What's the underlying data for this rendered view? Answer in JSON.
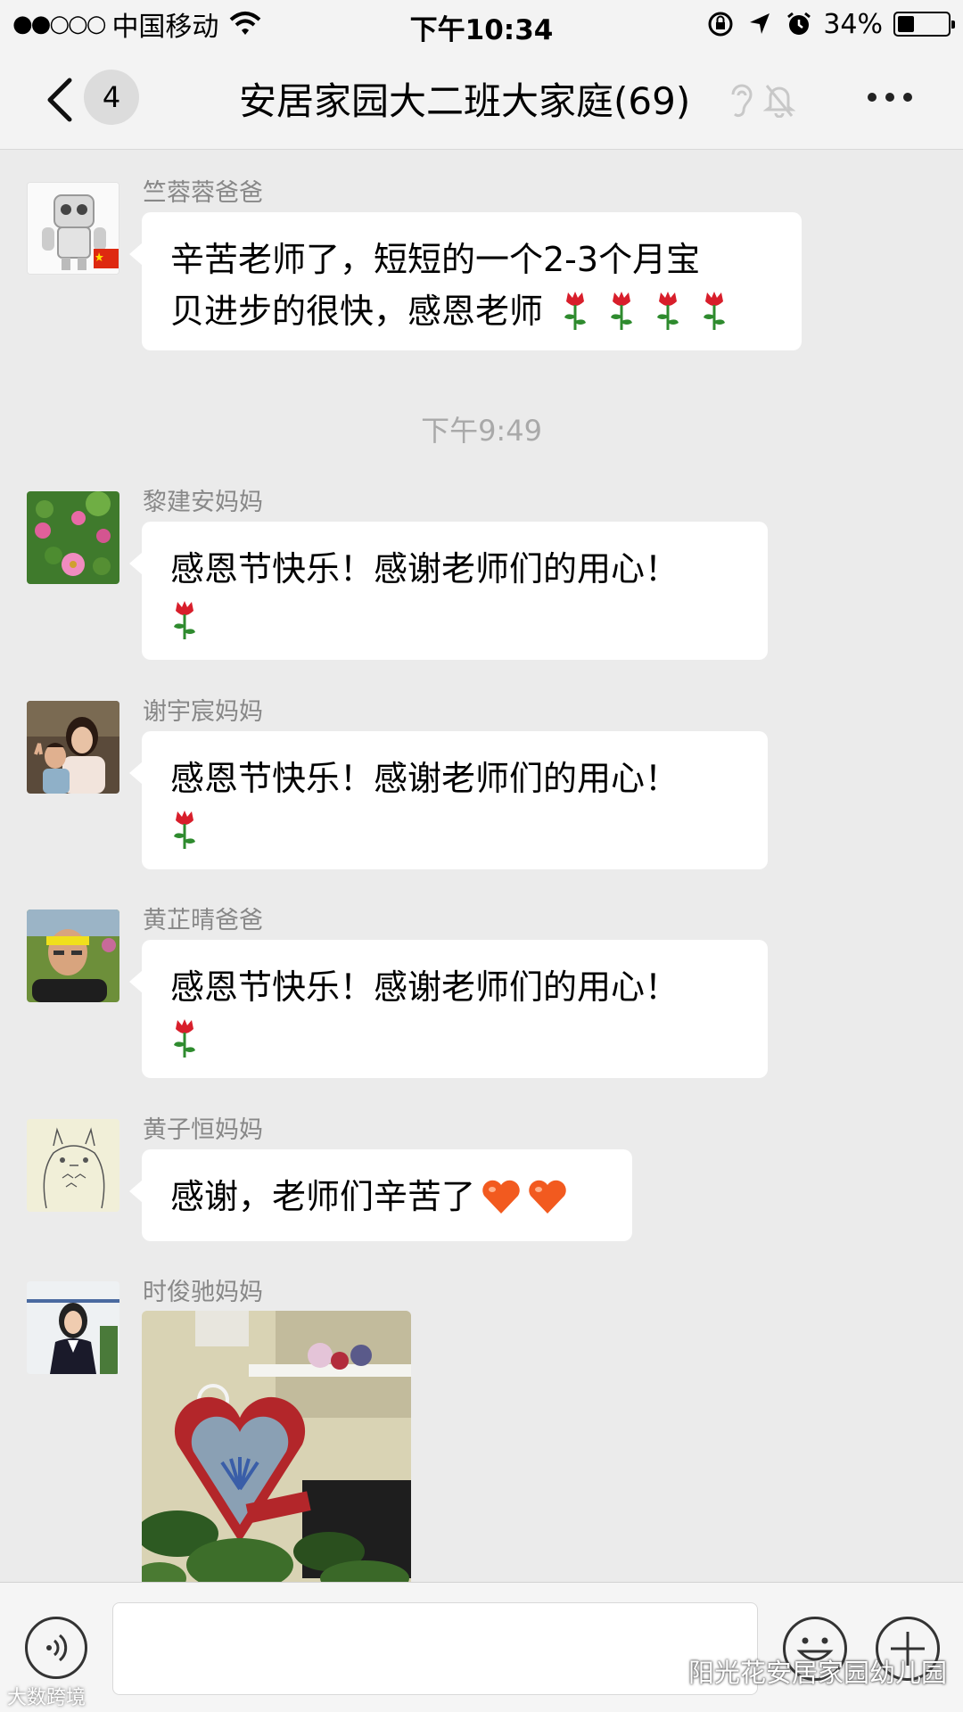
{
  "status_bar": {
    "signal": "●●○○○",
    "carrier": "中国移动",
    "time": "下午10:34",
    "battery": "34%",
    "battery_level": 0.34
  },
  "nav": {
    "unread_count": "4",
    "title": "安居家园大二班大家庭(69)"
  },
  "messages": [
    {
      "sender": "竺蓉蓉爸爸",
      "line1": "辛苦老师了，短短的一个2-3个月宝",
      "line2": "贝进步的很快，感恩老师"
    },
    {
      "sender": "黎建安妈妈",
      "line1": "感恩节快乐！感谢老师们的用心！"
    },
    {
      "sender": "谢宇宸妈妈",
      "line1": "感恩节快乐！感谢老师们的用心！"
    },
    {
      "sender": "黄芷晴爸爸",
      "line1": "感恩节快乐！感谢老师们的用心！"
    },
    {
      "sender": "黄子恒妈妈",
      "line1": "感谢，老师们辛苦了"
    },
    {
      "sender": "时俊驰妈妈"
    }
  ],
  "timestamp": "下午9:49",
  "watermark": "阳光花安居家园幼儿园",
  "watermark_small": "大数跨境",
  "colors": {
    "background": "#ebebeb",
    "bubble": "#ffffff",
    "rose": "#d81e2b",
    "heart": "#f25a1f"
  }
}
